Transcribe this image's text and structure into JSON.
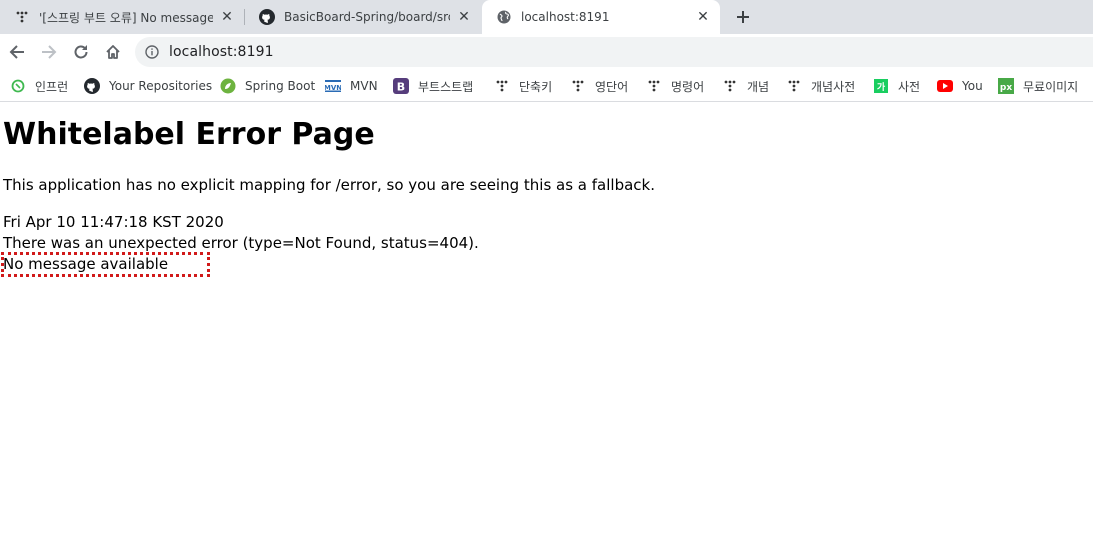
{
  "tabs": [
    {
      "title": "'[스프링 부트 오류] No message",
      "favicon": "tistory-icon",
      "active": false
    },
    {
      "title": "BasicBoard-Spring/board/src/ma",
      "favicon": "github-icon",
      "active": false
    },
    {
      "title": "localhost:8191",
      "favicon": "globe-icon",
      "active": true
    }
  ],
  "toolbar": {
    "url": "localhost:8191",
    "url_host": "localhost",
    "url_port": ":8191"
  },
  "bookmarks": [
    {
      "label": "인프런",
      "icon": "inflearn-icon"
    },
    {
      "label": "Your Repositories",
      "icon": "github-icon"
    },
    {
      "label": "Spring Boot",
      "icon": "spring-icon"
    },
    {
      "label": "MVN",
      "icon": "mvn-icon"
    },
    {
      "label": "부트스트랩",
      "icon": "bootstrap-icon"
    },
    {
      "label": "단축키",
      "icon": "tistory-icon"
    },
    {
      "label": "영단어",
      "icon": "tistory-icon"
    },
    {
      "label": "명령어",
      "icon": "tistory-icon"
    },
    {
      "label": "개념",
      "icon": "tistory-icon"
    },
    {
      "label": "개념사전",
      "icon": "tistory-icon"
    },
    {
      "label": "사전",
      "icon": "naver-dict-icon"
    },
    {
      "label": "You",
      "icon": "youtube-icon"
    },
    {
      "label": "무료이미지",
      "icon": "pixabay-icon"
    }
  ],
  "page": {
    "heading": "Whitelabel Error Page",
    "description": "This application has no explicit mapping for /error, so you are seeing this as a fallback.",
    "timestamp": "Fri Apr 10 11:47:18 KST 2020",
    "error_line": "There was an unexpected error (type=Not Found, status=404).",
    "message": "No message available"
  },
  "colors": {
    "tabstrip_bg": "#dee1e6",
    "omnibox_bg": "#f1f3f4",
    "highlight_border": "#d11a1a"
  }
}
